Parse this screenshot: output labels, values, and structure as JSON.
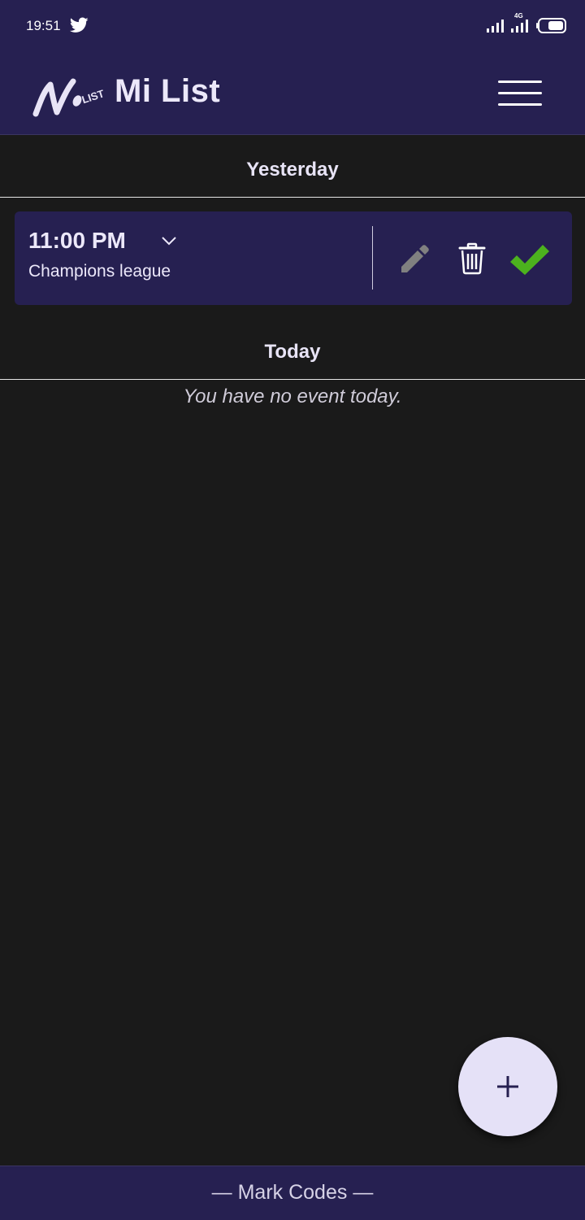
{
  "status_bar": {
    "time": "19:51",
    "network_label": "4G",
    "icons": [
      "twitter-icon",
      "signal-icon",
      "signal-icon",
      "battery-icon"
    ]
  },
  "app_bar": {
    "title": "Mi List",
    "logo_text": "LIST",
    "icons": [
      "logo-icon",
      "menu-icon"
    ]
  },
  "sections": [
    {
      "header": "Yesterday",
      "events": [
        {
          "time": "11:00 PM",
          "name": "Champions league",
          "icons": [
            "chevron-down-icon",
            "edit-icon",
            "delete-icon",
            "checkmark-icon"
          ]
        }
      ]
    },
    {
      "header": "Today",
      "empty_message": "You have no event today."
    }
  ],
  "fab": {
    "icon": "plus-icon"
  },
  "footer": {
    "text": "— Mark Codes —"
  },
  "colors": {
    "background": "#1a1a1a",
    "surface": "#262051",
    "text": "#ece8fa",
    "check_green": "#4cb21e",
    "edit_gray": "#808080",
    "fab": "#e5e1f7"
  }
}
